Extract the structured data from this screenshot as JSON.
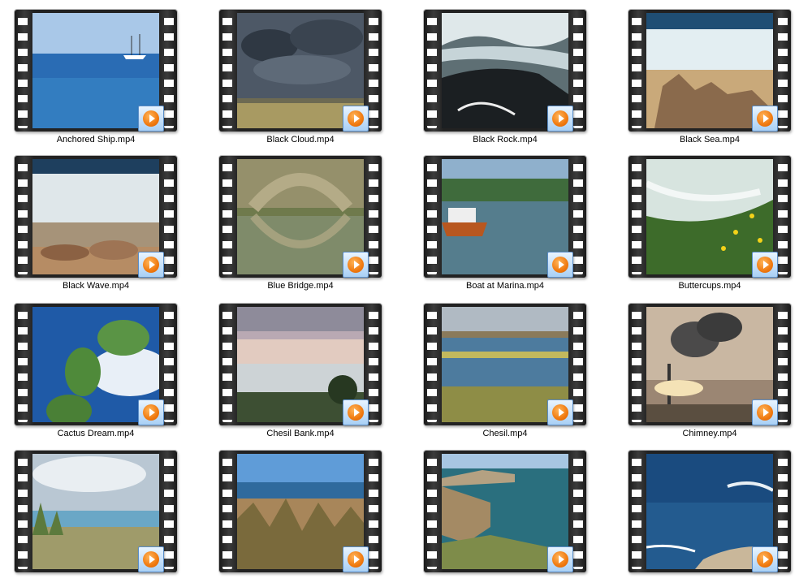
{
  "files": [
    {
      "name": "Anchored Ship.mp4",
      "thumb": "sea-ship"
    },
    {
      "name": "Black Cloud.mp4",
      "thumb": "storm"
    },
    {
      "name": "Black Rock.mp4",
      "thumb": "rock"
    },
    {
      "name": "Black Sea.mp4",
      "thumb": "rocks-shore"
    },
    {
      "name": "Black Wave.mp4",
      "thumb": "wave"
    },
    {
      "name": "Blue Bridge.mp4",
      "thumb": "bridge"
    },
    {
      "name": "Boat at Marina.mp4",
      "thumb": "boat"
    },
    {
      "name": "Buttercups.mp4",
      "thumb": "buttercups"
    },
    {
      "name": "Cactus Dream.mp4",
      "thumb": "cactus"
    },
    {
      "name": "Chesil Bank.mp4",
      "thumb": "chesil-bank"
    },
    {
      "name": "Chesil.mp4",
      "thumb": "lagoon"
    },
    {
      "name": "Chimney.mp4",
      "thumb": "chimney"
    },
    {
      "name": "",
      "thumb": "cloudy-beach"
    },
    {
      "name": "",
      "thumb": "grass-sea"
    },
    {
      "name": "",
      "thumb": "cliffs"
    },
    {
      "name": "",
      "thumb": "deep-sea"
    }
  ],
  "icons": {
    "badge": "media-player-icon"
  }
}
